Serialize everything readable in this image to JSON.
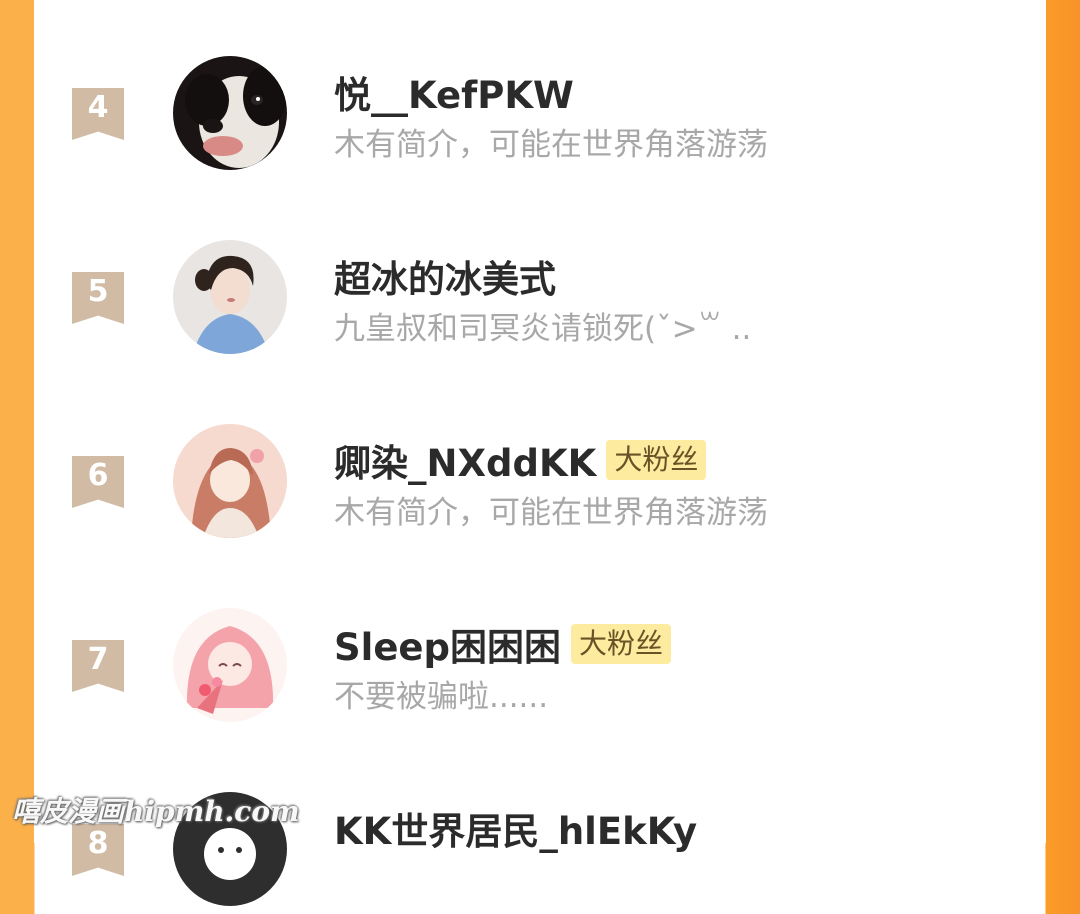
{
  "fans": [
    {
      "rank": "4",
      "name": "悦__KefPKW",
      "badge": "",
      "bio": "木有简介，可能在世界角落游荡"
    },
    {
      "rank": "5",
      "name": "超冰的冰美式",
      "badge": "",
      "bio": "九皇叔和司冥炎请锁死(ˇ>꒳ .."
    },
    {
      "rank": "6",
      "name": "卿染_NXddKK",
      "badge": "大粉丝",
      "bio": "木有简介，可能在世界角落游荡"
    },
    {
      "rank": "7",
      "name": "Sleep困困困",
      "badge": "大粉丝",
      "bio": "不要被骗啦......"
    },
    {
      "rank": "8",
      "name": "KK世界居民_hlEkKy",
      "badge": "",
      "bio": ""
    }
  ],
  "watermark": "嘻皮漫画hipmh.com",
  "colors": {
    "left_edge": "#fbb04a",
    "right_edge": "#f89327",
    "rank_ribbon": "#d1bba4",
    "badge_bg": "#fdeca0"
  }
}
